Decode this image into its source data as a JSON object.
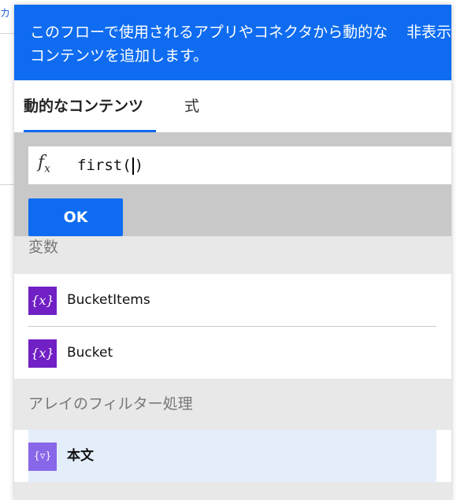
{
  "background": {
    "left_tab_text": "カ"
  },
  "banner": {
    "text": "このフローで使用されるアプリやコネクタから動的なコンテンツを追加します。",
    "hide_label": "非表示"
  },
  "tabs": [
    {
      "label": "動的なコンテンツ",
      "active": true
    },
    {
      "label": "式",
      "active": false
    }
  ],
  "expression": {
    "icon": "fx-icon",
    "value_before_caret": "first(",
    "value_after_caret": ")",
    "ok_label": "OK"
  },
  "sections": [
    {
      "title": "変数",
      "items": [
        {
          "icon": "{x}",
          "label": "BucketItems"
        },
        {
          "icon": "{x}",
          "label": "Bucket"
        }
      ]
    },
    {
      "title": "アレイのフィルター処理",
      "items": [
        {
          "icon": "{▿}",
          "label": "本文",
          "highlighted": true
        }
      ]
    }
  ],
  "colors": {
    "accent": "#0f6cf0",
    "variable_icon": "#7020c4",
    "filter_icon": "#8867e8",
    "highlight_row": "#e4eefb"
  }
}
